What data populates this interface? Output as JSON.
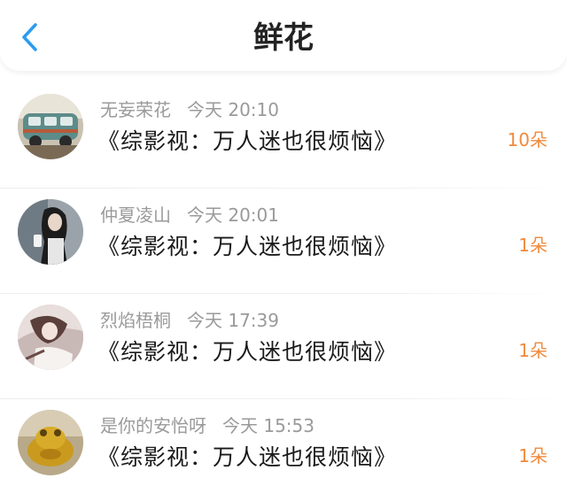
{
  "header": {
    "title": "鲜花",
    "back_icon": "chevron-left-icon",
    "accent_color": "#2b9cf0"
  },
  "count_color": "#f08a3c",
  "items": [
    {
      "name": "无妄荣花",
      "time": "今天 20:10",
      "book": "《综影视：万人迷也很烦恼》",
      "count": "10朵",
      "avatar": "vintage-van-avatar"
    },
    {
      "name": "仲夏凌山",
      "time": "今天 20:01",
      "book": "《综影视：万人迷也很烦恼》",
      "count": "1朵",
      "avatar": "girl-with-cup-avatar"
    },
    {
      "name": "烈焰梧桐",
      "time": "今天 17:39",
      "book": "《综影视：万人迷也很烦恼》",
      "count": "1朵",
      "avatar": "anime-figure-avatar"
    },
    {
      "name": "是你的安怡呀",
      "time": "今天 15:53",
      "book": "《综影视：万人迷也很烦恼》",
      "count": "1朵",
      "avatar": "golden-toad-avatar"
    }
  ]
}
